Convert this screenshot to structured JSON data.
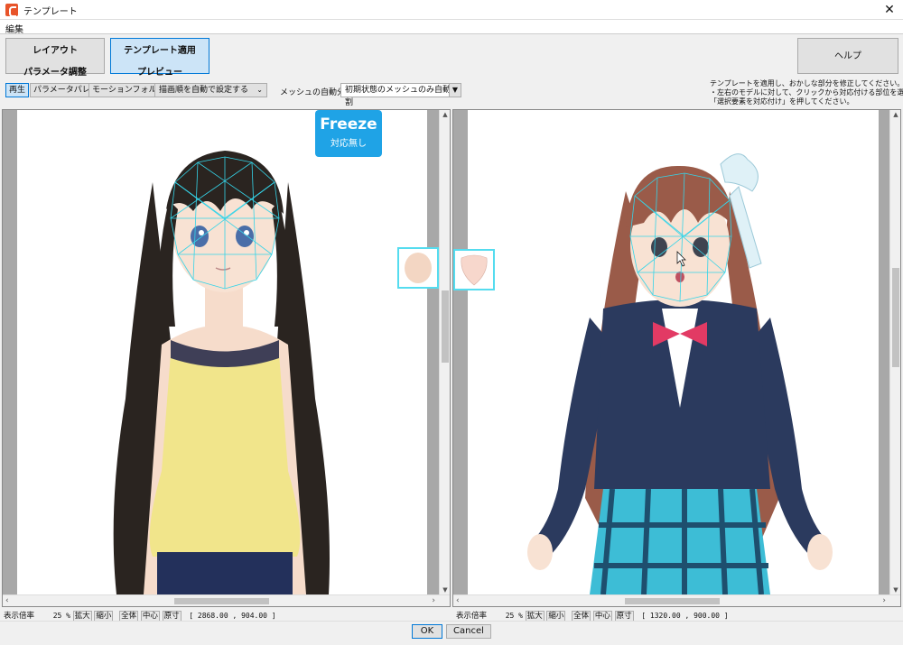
{
  "window": {
    "title": "テンプレート",
    "close_glyph": "✕"
  },
  "menu": {
    "edit": "編集"
  },
  "tabs": {
    "layout": {
      "line1": "レイアウト",
      "line2": "パラメータ調整"
    },
    "template": {
      "line1": "テンプレート適用",
      "line2": "プレビュー"
    }
  },
  "help_label": "ヘルプ",
  "toolbar": {
    "play": "再生",
    "param_palette": "パラメータパレット",
    "motion_folder": "モーションフォルダ",
    "draw_order": "描画順を自動で設定する",
    "mesh_label": "メッシュの自動分割",
    "mesh_value": "初期状態のメッシュのみ自動分割"
  },
  "instructions": {
    "line1": "テンプレートを適用し、おかしな部分を修正してください。",
    "line2": "・左右のモデルに対して、クリックから対応付ける部位を選び、",
    "line3": "「選択要素を対応付け」を押してください。"
  },
  "freeze": {
    "title": "Freeze",
    "subtitle": "対応無し"
  },
  "status_left": {
    "zoom_label": "表示倍率",
    "zoom_value": "25 %",
    "zoom_in": "拡大",
    "zoom_out": "縮小",
    "fit": "全体",
    "center": "中心",
    "actual": "原寸",
    "coords": "[ 2868.00 , 904.00 ]"
  },
  "status_right": {
    "zoom_label": "表示倍率",
    "zoom_value": "25 %",
    "zoom_in": "拡大",
    "zoom_out": "縮小",
    "fit": "全体",
    "center": "中心",
    "actual": "原寸",
    "coords": "[ 1320.00 , 900.00 ]"
  },
  "dialog": {
    "ok": "OK",
    "cancel": "Cancel"
  },
  "colors": {
    "accent": "#0078d7",
    "freeze": "#1fa3e6",
    "mesh": "#35d4e8",
    "selected_tab": "#cce4f7"
  }
}
